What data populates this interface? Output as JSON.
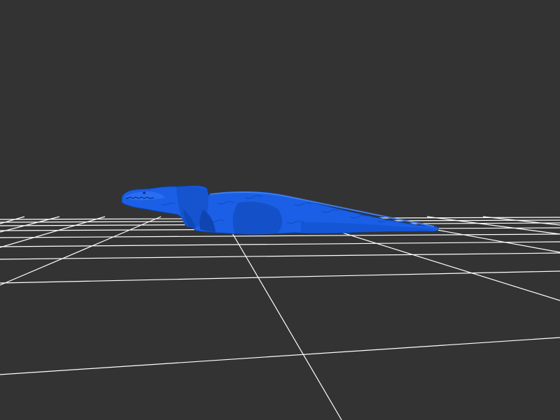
{
  "viewport": {
    "background_color": "#333333"
  },
  "grid": {
    "line_color": "#ffffff",
    "visible": true
  },
  "model": {
    "subject": "tyrannosaurus",
    "color": "#1a5fe6",
    "shade_color": "#0d3f9e",
    "highlight_color": "#3d7ef2"
  }
}
